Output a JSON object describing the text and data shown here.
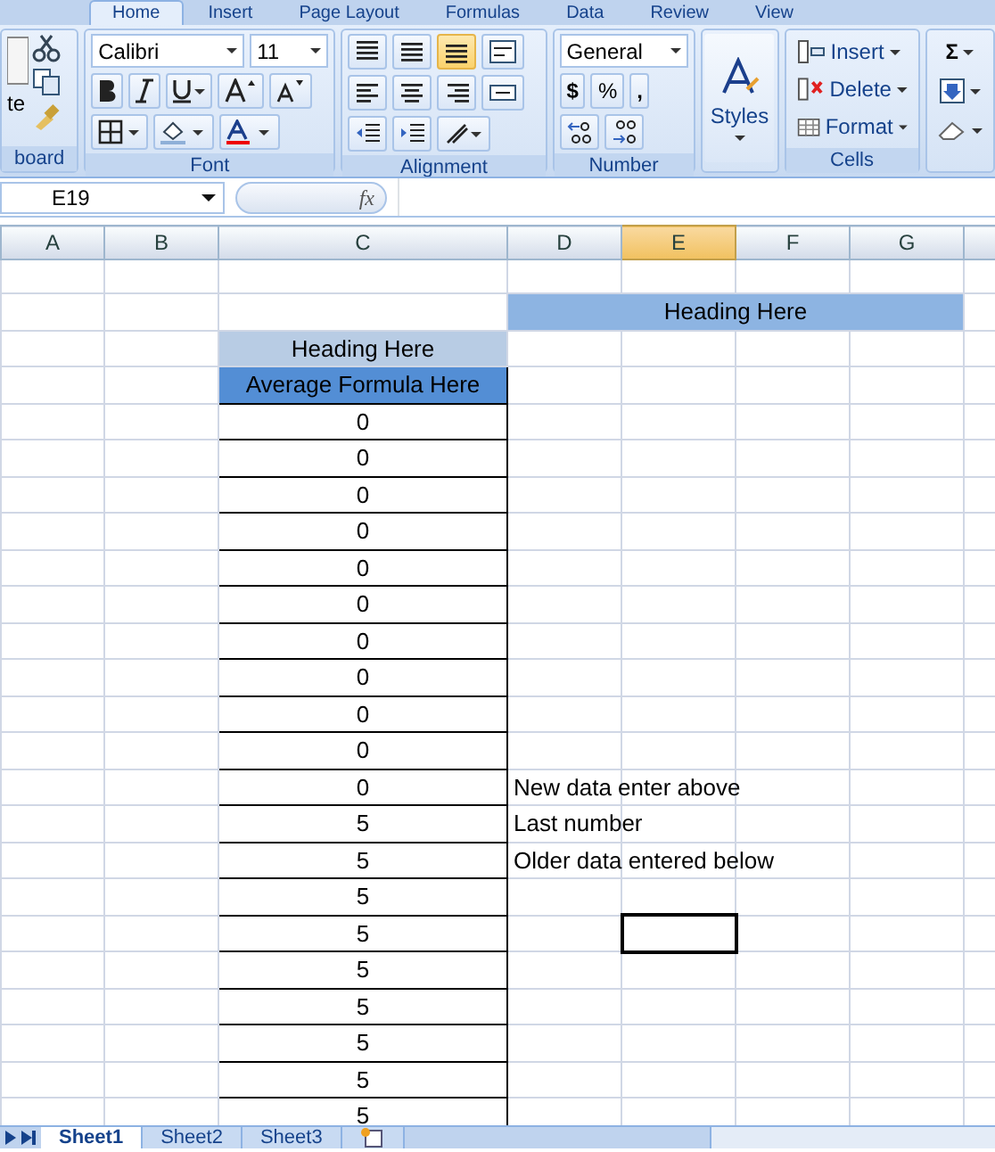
{
  "ribbon_tabs": [
    {
      "label": "Home",
      "selected": true
    },
    {
      "label": "Insert",
      "selected": false
    },
    {
      "label": "Page Layout",
      "selected": false
    },
    {
      "label": "Formulas",
      "selected": false
    },
    {
      "label": "Data",
      "selected": false
    },
    {
      "label": "Review",
      "selected": false
    },
    {
      "label": "View",
      "selected": false
    }
  ],
  "clipboard": {
    "paste_label": "te",
    "group_label": "board"
  },
  "font": {
    "name": "Calibri",
    "size": "11",
    "group_label": "Font"
  },
  "alignment": {
    "group_label": "Alignment"
  },
  "number": {
    "format": "General",
    "currency": "$",
    "percent": "%",
    "comma": ",",
    "group_label": "Number"
  },
  "styles": {
    "label": "Styles"
  },
  "cells": {
    "buttons": [
      "Insert",
      "Delete",
      "Format"
    ],
    "group_label": "Cells"
  },
  "editing": {
    "sum": "Σ"
  },
  "name_box": "E19",
  "function_label": "fx",
  "columns": [
    {
      "label": "A",
      "selected": false
    },
    {
      "label": "B",
      "selected": false
    },
    {
      "label": "C",
      "selected": false
    },
    {
      "label": "D",
      "selected": false
    },
    {
      "label": "E",
      "selected": true
    },
    {
      "label": "F",
      "selected": false
    },
    {
      "label": "G",
      "selected": false
    }
  ],
  "rows": [
    {
      "kind": "blank",
      "c": "",
      "d": "",
      "e_selected": false
    },
    {
      "kind": "top_heading",
      "c": "",
      "d": "Heading Here"
    },
    {
      "kind": "heading",
      "c": "Heading Here",
      "d": "",
      "e_selected": false
    },
    {
      "kind": "formula_heading",
      "c": "Average Formula Here",
      "d": "",
      "e_selected": false
    },
    {
      "kind": "value",
      "c": "0",
      "d": "",
      "e_selected": false
    },
    {
      "kind": "value",
      "c": "0",
      "d": "",
      "e_selected": false
    },
    {
      "kind": "value",
      "c": "0",
      "d": "",
      "e_selected": false
    },
    {
      "kind": "value",
      "c": "0",
      "d": "",
      "e_selected": false
    },
    {
      "kind": "value",
      "c": "0",
      "d": "",
      "e_selected": false
    },
    {
      "kind": "value",
      "c": "0",
      "d": "",
      "e_selected": false
    },
    {
      "kind": "value",
      "c": "0",
      "d": "",
      "e_selected": false
    },
    {
      "kind": "value",
      "c": "0",
      "d": "",
      "e_selected": false
    },
    {
      "kind": "value",
      "c": "0",
      "d": "",
      "e_selected": false
    },
    {
      "kind": "value",
      "c": "0",
      "d": "",
      "e_selected": false
    },
    {
      "kind": "value",
      "c": "0",
      "d": "New data enter above",
      "e_selected": false
    },
    {
      "kind": "value",
      "c": "5",
      "d": "Last number",
      "e_selected": false
    },
    {
      "kind": "value",
      "c": "5",
      "d": "Older data entered below",
      "e_selected": false
    },
    {
      "kind": "value",
      "c": "5",
      "d": "",
      "e_selected": false
    },
    {
      "kind": "value",
      "c": "5",
      "d": "",
      "e_selected": true
    },
    {
      "kind": "value",
      "c": "5",
      "d": "",
      "e_selected": false
    },
    {
      "kind": "value",
      "c": "5",
      "d": "",
      "e_selected": false
    },
    {
      "kind": "value",
      "c": "5",
      "d": "",
      "e_selected": false
    },
    {
      "kind": "value",
      "c": "5",
      "d": "",
      "e_selected": false
    },
    {
      "kind": "value",
      "c": "5",
      "d": "",
      "e_selected": false
    }
  ],
  "sheet_tabs": [
    {
      "label": "Sheet1",
      "selected": true
    },
    {
      "label": "Sheet2",
      "selected": false
    },
    {
      "label": "Sheet3",
      "selected": false
    }
  ]
}
